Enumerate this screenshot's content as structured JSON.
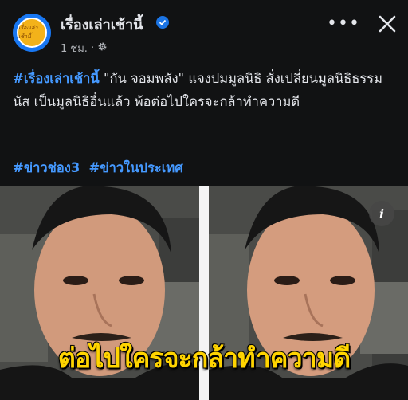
{
  "header": {
    "page_name": "เรื่องเล่าเช้านี้",
    "avatar_text": "เรื่องเล่าเช้านี้",
    "timestamp": "1 ชม.",
    "separator": "·",
    "audience_icon": "gear-icon",
    "verified_icon": "verified-badge-icon",
    "more_icon": "more-dots-icon",
    "more_glyph": "•••",
    "close_icon": "close-icon"
  },
  "post": {
    "hashtag_lead": "#เรื่องเล่าเช้านี้",
    "body": " \"กัน จอมพลัง\" แจงปมมูลนิธิ สั่งเปลี่ยนมูลนิธิธรรมนัส เป็นมูลนิธิอื่นแล้ว พ้อต่อไปใครจะกล้าทำความดี",
    "tags": [
      "#ข่าวช่อง3",
      "#ข่าวในประเทศ"
    ]
  },
  "image": {
    "caption": "ต่อไปใครจะกล้าทำความดี",
    "info_icon": "info-icon",
    "info_glyph": "i"
  },
  "colors": {
    "background": "#111213",
    "hashtag": "#4599ff",
    "caption": "#ffd400",
    "verified": "#1b74e4"
  }
}
